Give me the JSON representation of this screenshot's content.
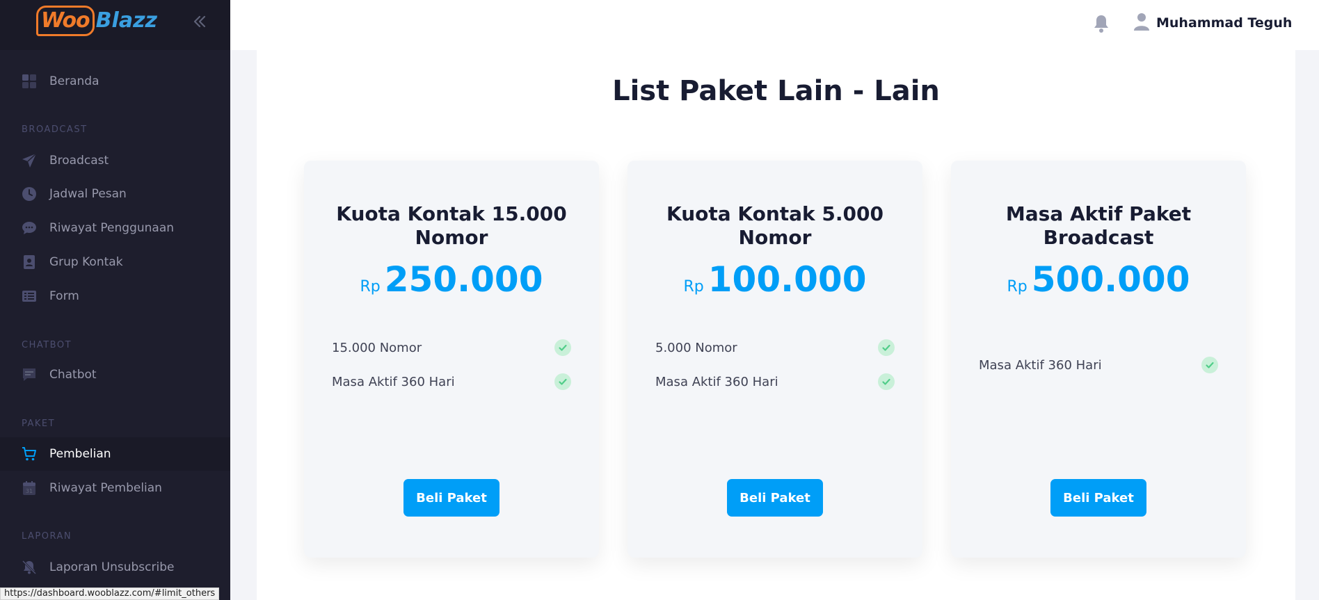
{
  "brand": {
    "logo_woo": "Woo",
    "logo_blazz": "Blazz"
  },
  "header": {
    "user_name": "Muhammad Teguh"
  },
  "sidebar": {
    "items": [
      {
        "label": "Beranda",
        "icon": "dashboard-icon"
      },
      {
        "label": "Broadcast",
        "icon": "paper-plane-icon"
      },
      {
        "label": "Jadwal Pesan",
        "icon": "clock-icon"
      },
      {
        "label": "Riwayat Penggunaan",
        "icon": "chat-bubble-icon"
      },
      {
        "label": "Grup Kontak",
        "icon": "contact-book-icon"
      },
      {
        "label": "Form",
        "icon": "list-icon"
      },
      {
        "label": "Chatbot",
        "icon": "message-icon"
      },
      {
        "label": "Pembelian",
        "icon": "cart-icon",
        "active": true
      },
      {
        "label": "Riwayat Pembelian",
        "icon": "calendar-icon"
      },
      {
        "label": "Laporan Unsubscribe",
        "icon": "bell-off-icon"
      }
    ],
    "sections": [
      "BROADCAST",
      "CHATBOT",
      "PAKET",
      "LAPORAN"
    ]
  },
  "main": {
    "title": "List Paket Lain - Lain",
    "cards": [
      {
        "title": "Kuota Kontak 15.000 Nomor",
        "currency": "Rp",
        "price": "250.000",
        "features": [
          "15.000 Nomor",
          "Masa Aktif 360 Hari"
        ],
        "button": "Beli Paket"
      },
      {
        "title": "Kuota Kontak 5.000 Nomor",
        "currency": "Rp",
        "price": "100.000",
        "features": [
          "5.000 Nomor",
          "Masa Aktif 360 Hari"
        ],
        "button": "Beli Paket"
      },
      {
        "title": "Masa Aktif Paket Broadcast",
        "currency": "Rp",
        "price": "500.000",
        "features": [
          "Masa Aktif 360 Hari"
        ],
        "button": "Beli Paket"
      }
    ]
  },
  "status_bar": {
    "url": "https://dashboard.wooblazz.com/#limit_others"
  },
  "colors": {
    "accent": "#009ef7",
    "sidebar_bg": "#1e1e2d",
    "check_bg": "#c9f0d9",
    "check_fg": "#50cd89"
  }
}
